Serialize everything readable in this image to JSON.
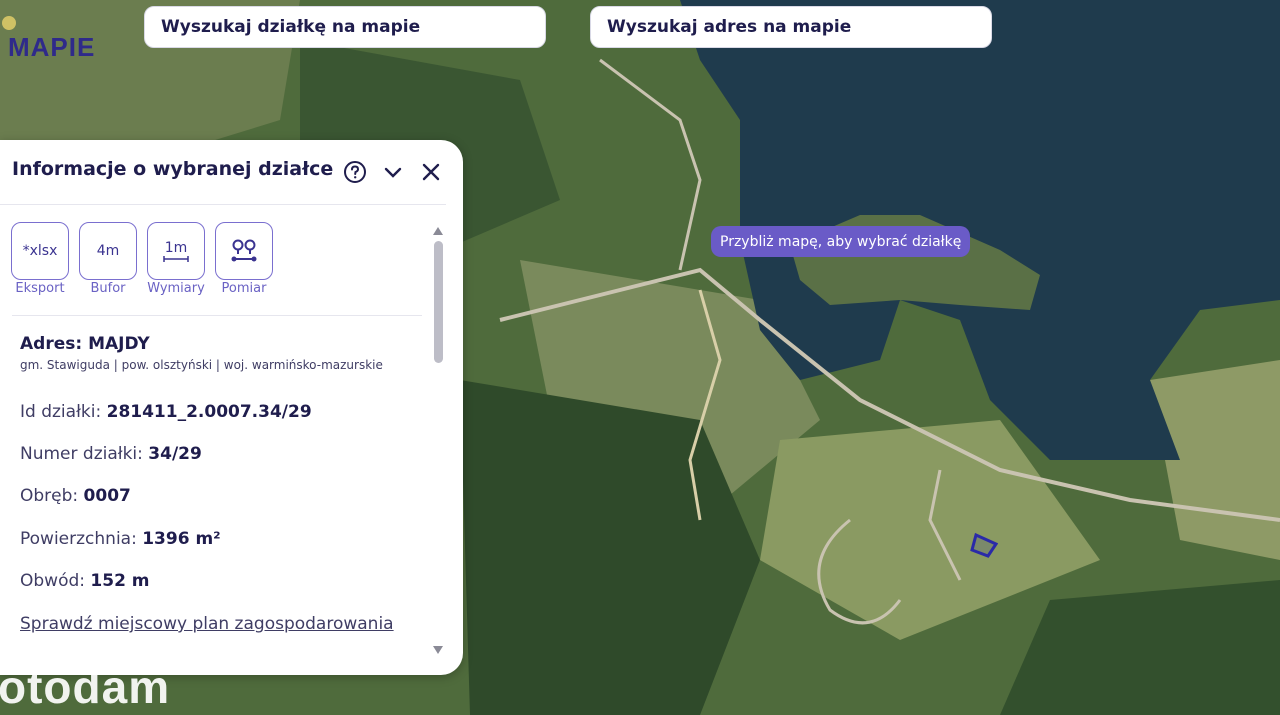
{
  "logo": {
    "text": "MAPIE"
  },
  "search": {
    "parcel_placeholder": "Wyszukaj działkę na mapie",
    "address_placeholder": "Wyszukaj adres na mapie"
  },
  "map": {
    "tooltip": "Przybliż mapę, aby wybrać działkę",
    "parcel_outline_color": "#2a2aa8"
  },
  "panel": {
    "title": "Informacje o wybranej działce",
    "tools": [
      {
        "icon_text": "*xlsx",
        "label": "Eksport"
      },
      {
        "icon_text": "4m",
        "label": "Bufor"
      },
      {
        "icon_text": "1m",
        "label": "Wymiary"
      },
      {
        "icon_text": "",
        "label": "Pomiar",
        "icon": "route-pins-icon"
      }
    ],
    "address": "Adres: MAJDY",
    "address_sub": "gm. Stawiguda | pow. olsztyński | woj. warmińsko-mazurskie",
    "fields": [
      {
        "label": "Id działki:",
        "value": "281411_2.0007.34/29"
      },
      {
        "label": "Numer działki:",
        "value": "34/29"
      },
      {
        "label": "Obręb:",
        "value": "0007"
      },
      {
        "label": "Powierzchnia:",
        "value": "1396 m²"
      },
      {
        "label": "Obwód:",
        "value": "152 m"
      }
    ],
    "plan_link": "Sprawdź miejscowy plan zagospodarowania"
  },
  "watermark": "otodam",
  "colors": {
    "accent": "#6a5bc7",
    "text_dark": "#1f1d4d"
  }
}
